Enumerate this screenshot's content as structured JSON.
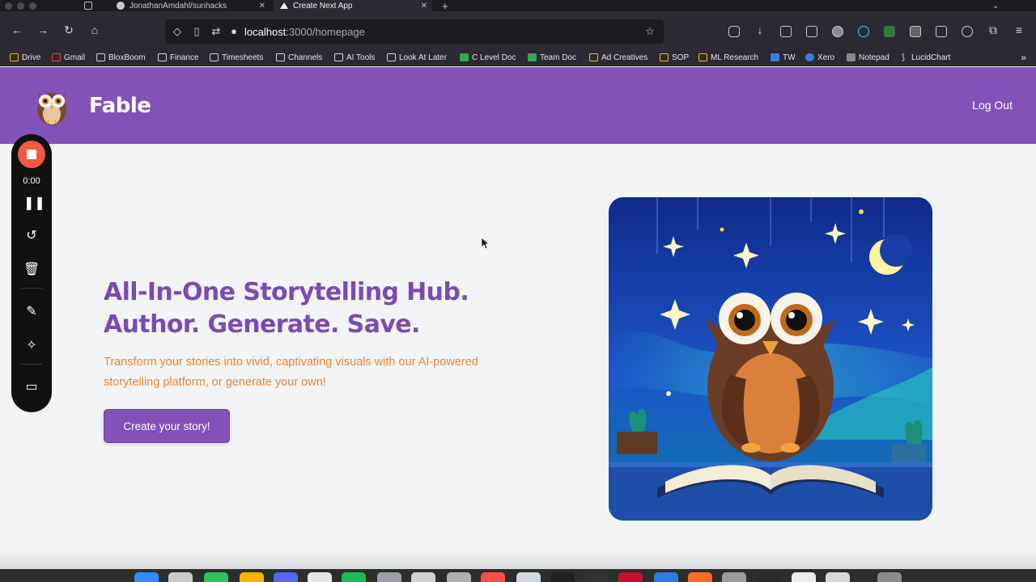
{
  "browser": {
    "tabs": [
      {
        "title": "JonathanAmdahl/sunhacks",
        "active": false
      },
      {
        "title": "Create Next App",
        "active": true
      }
    ],
    "url_host": "localhost",
    "url_path": ":3000/homepage",
    "bookmarks": [
      "Drive",
      "Gmail",
      "BloxBoom",
      "Finance",
      "Timesheets",
      "Channels",
      "AI Tools",
      "Look At Later",
      "C Level Doc",
      "Team Doc",
      "Ad Creatives",
      "SOP",
      "ML Research",
      "TW",
      "Xero",
      "Notepad",
      "LucidChart"
    ]
  },
  "header": {
    "brand": "Fable",
    "logout_label": "Log Out"
  },
  "hero": {
    "title_line1": "All-In-One Storytelling Hub.",
    "title_line2": "Author. Generate. Save.",
    "subtitle": "Transform your stories into vivid, captivating visuals with our AI-powered storytelling platform, or generate your own!",
    "cta_label": "Create your story!"
  },
  "recorder": {
    "time": "0:00"
  },
  "colors": {
    "brand_purple": "#8252b9",
    "title_purple": "#7b4bb4",
    "accent_orange": "#e88735",
    "record_red": "#f05a3f"
  }
}
